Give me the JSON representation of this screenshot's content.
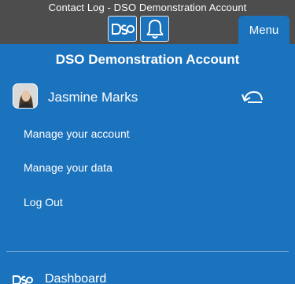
{
  "header": {
    "app_title": "Contact Log - DSO Demonstration Account",
    "dso_logo_label": "DSO",
    "menu_label": "Menu"
  },
  "menu_panel": {
    "account_name": "DSO Demonstration Account",
    "user_name": "Jasmine Marks",
    "items": [
      {
        "label": "Manage your account"
      },
      {
        "label": "Manage your data"
      },
      {
        "label": "Log Out"
      }
    ],
    "nav": [
      {
        "label": "Dashboard",
        "icon": "dso-logo-icon"
      }
    ]
  },
  "colors": {
    "topbar": "#4d4d4d",
    "panel": "#1b72bd",
    "text": "#ffffff"
  }
}
